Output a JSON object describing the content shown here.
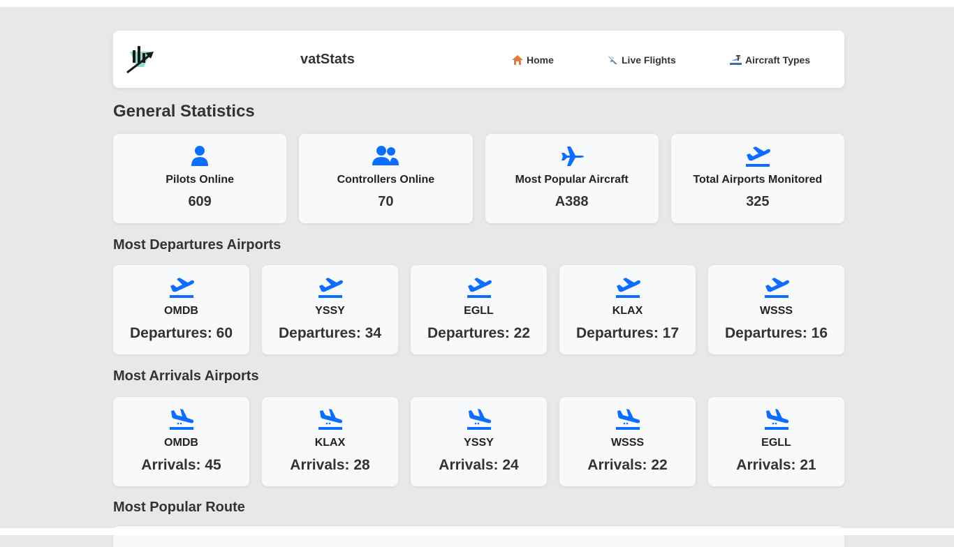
{
  "navbar": {
    "brand": "vatStats",
    "links": [
      {
        "label": "Home",
        "icon": "house-icon"
      },
      {
        "label": "Live Flights",
        "icon": "airplane-icon"
      },
      {
        "label": "Aircraft Types",
        "icon": "airport-icon"
      }
    ]
  },
  "general": {
    "title": "General Statistics",
    "cards": [
      {
        "label": "Pilots Online",
        "value": "609",
        "icon": "user-icon"
      },
      {
        "label": "Controllers Online",
        "value": "70",
        "icon": "users-icon"
      },
      {
        "label": "Most Popular Aircraft",
        "value": "A388",
        "icon": "plane-icon"
      },
      {
        "label": "Total Airports Monitored",
        "value": "325",
        "icon": "plane-departure-icon"
      }
    ]
  },
  "departures": {
    "title": "Most Departures Airports",
    "items": [
      {
        "airport": "OMDB",
        "text": "Departures: 60"
      },
      {
        "airport": "YSSY",
        "text": "Departures: 34"
      },
      {
        "airport": "EGLL",
        "text": "Departures: 22"
      },
      {
        "airport": "KLAX",
        "text": "Departures: 17"
      },
      {
        "airport": "WSSS",
        "text": "Departures: 16"
      }
    ]
  },
  "arrivals": {
    "title": "Most Arrivals Airports",
    "items": [
      {
        "airport": "OMDB",
        "text": "Arrivals: 45"
      },
      {
        "airport": "KLAX",
        "text": "Arrivals: 28"
      },
      {
        "airport": "YSSY",
        "text": "Arrivals: 24"
      },
      {
        "airport": "WSSS",
        "text": "Arrivals: 22"
      },
      {
        "airport": "EGLL",
        "text": "Arrivals: 21"
      }
    ]
  },
  "route": {
    "title": "Most Popular Route"
  },
  "colors": {
    "accent": "#0d6efd",
    "background": "#e8e8e8",
    "card": "#f8f9fa",
    "text": "#333333"
  }
}
